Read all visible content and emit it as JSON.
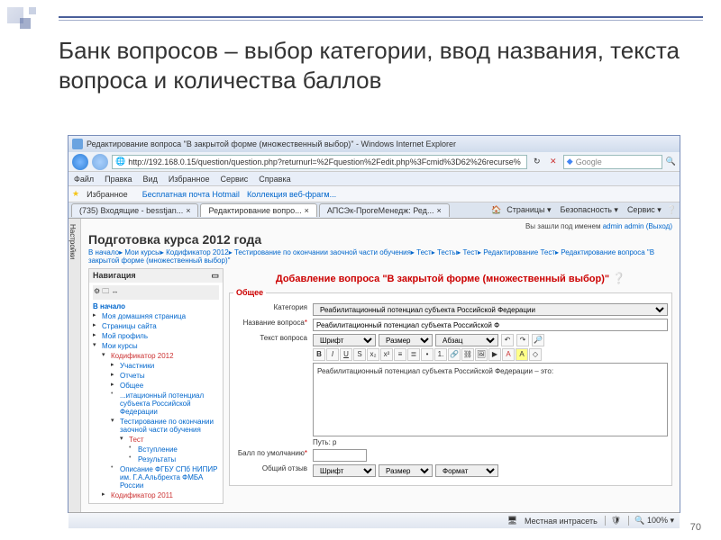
{
  "slide": {
    "title": "Банк вопросов – выбор категории, ввод названия, текста вопроса и количества баллов",
    "page": "70"
  },
  "ie": {
    "window_title": "Редактирование вопроса \"В закрытой форме (множественный выбор)\" - Windows Internet Explorer",
    "url": "http://192.168.0.15/question/question.php?returnurl=%2Fquestion%2Fedit.php%3Fcmid%3D62%26recurse%",
    "search_placeholder": "Google",
    "menu": [
      "Файл",
      "Правка",
      "Вид",
      "Избранное",
      "Сервис",
      "Справка"
    ],
    "fav_label": "Избранное",
    "fav_links": [
      "Бесплатная почта Hotmail",
      "Коллекция веб-фрагм..."
    ],
    "tabs": [
      "(735) Входящие - besstjan...",
      "Редактирование вопро...",
      "АПСЭк-ПрогеМенедж: Ред..."
    ],
    "toolbar": [
      "Страницы ▾",
      "Безопасность ▾",
      "Сервис ▾"
    ],
    "status": {
      "zone": "Местная интрасеть",
      "zoom": "100%"
    }
  },
  "moodle": {
    "login": {
      "prefix": "Вы зашли под именем",
      "user": "admin admin",
      "logout": "(Выход)"
    },
    "setting_tab": "Настройки",
    "course_title": "Подготовка курса 2012 года",
    "breadcrumb": "В начало▸ Мои курсы▸ Кодификатор 2012▸ Тестирование по окончании заочной части обучения▸ Тест▸ Тесты▸ Тест▸ Редактирование Тест▸ Редактирование вопроса \"В закрытой форме (множественный выбор)\"",
    "nav": {
      "title": "Навигация",
      "home": "В начало",
      "items": [
        "Моя домашняя страница",
        "Страницы сайта",
        "Мой профиль",
        "Мои курсы"
      ],
      "course": "Кодификатор 2012",
      "sub": [
        "Участники",
        "Отчеты",
        "Общее",
        "...итационный потенциал субъекта Российской Федерации",
        "Тестирование по окончании заочной части обучения"
      ],
      "test": "Тест",
      "testsub": [
        "Вступление",
        "Результаты"
      ],
      "more": [
        "Описание ФГБУ СПб НИПИР им. Г.А.Альбрехта ФМБА России",
        "Кодификатор 2011"
      ]
    },
    "form": {
      "heading": "Добавление вопроса \"В закрытой форме (множественный выбор)\"",
      "legend": "Общее",
      "category_label": "Категория",
      "category_value": "Реабилитационный потенциал субъекта Российской Федерации",
      "name_label": "Название вопроса",
      "name_value": "Реабилитационный потенциал субъекта Российской Ф",
      "text_label": "Текст вопроса",
      "editor_selects": [
        "Шрифт",
        "Размер",
        "Абзац"
      ],
      "body": "Реабилитационный потенциал субъекта Российской Федерации – это:",
      "path_label": "Путь: p",
      "score_label": "Балл по умолчанию",
      "feedback_label": "Общий отзыв",
      "fb_selects": [
        "Шрифт",
        "Размер",
        "Формат"
      ]
    }
  }
}
